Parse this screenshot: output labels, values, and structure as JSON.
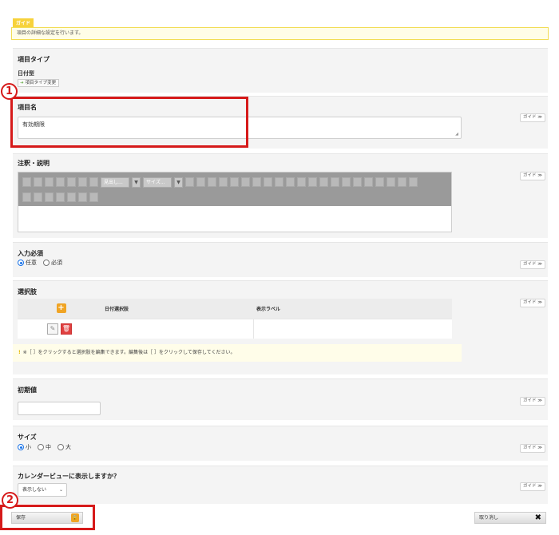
{
  "guide": {
    "tag": "ガイド",
    "text": "項目の詳細な設定を行います。"
  },
  "guide_button": "ガイド ≫",
  "item_type": {
    "title": "項目タイプ",
    "value": "日付型",
    "change_label": "項目タイプ変更"
  },
  "item_name": {
    "title": "項目名",
    "value": "有効期限"
  },
  "notes": {
    "title": "注釈・説明",
    "toolbar": {
      "format_select": "見出し...",
      "size_select": "サイズ..."
    }
  },
  "required": {
    "title": "入力必須",
    "options": [
      {
        "label": "任意",
        "selected": true
      },
      {
        "label": "必須",
        "selected": false
      }
    ]
  },
  "choices": {
    "title": "選択肢",
    "columns": [
      "日付選択肢",
      "表示ラベル"
    ],
    "note": "※［ ］をクリックすると選択肢を編集できます。編集後は［ ］をクリックして保存してください。"
  },
  "initial_value": {
    "title": "初期値",
    "value": ""
  },
  "size": {
    "title": "サイズ",
    "options": [
      {
        "label": "小",
        "selected": true
      },
      {
        "label": "中",
        "selected": false
      },
      {
        "label": "大",
        "selected": false
      }
    ]
  },
  "calendar": {
    "title": "カレンダービューに表示しますか？",
    "selected": "表示しない"
  },
  "buttons": {
    "save": "保存",
    "cancel": "取り消し"
  },
  "callouts": [
    "1",
    "2"
  ],
  "colors": {
    "accent_red": "#d61a1a",
    "guide_yellow": "#f7d23b",
    "radio_blue": "#1a73e8",
    "orange_icon": "#f0a424"
  }
}
